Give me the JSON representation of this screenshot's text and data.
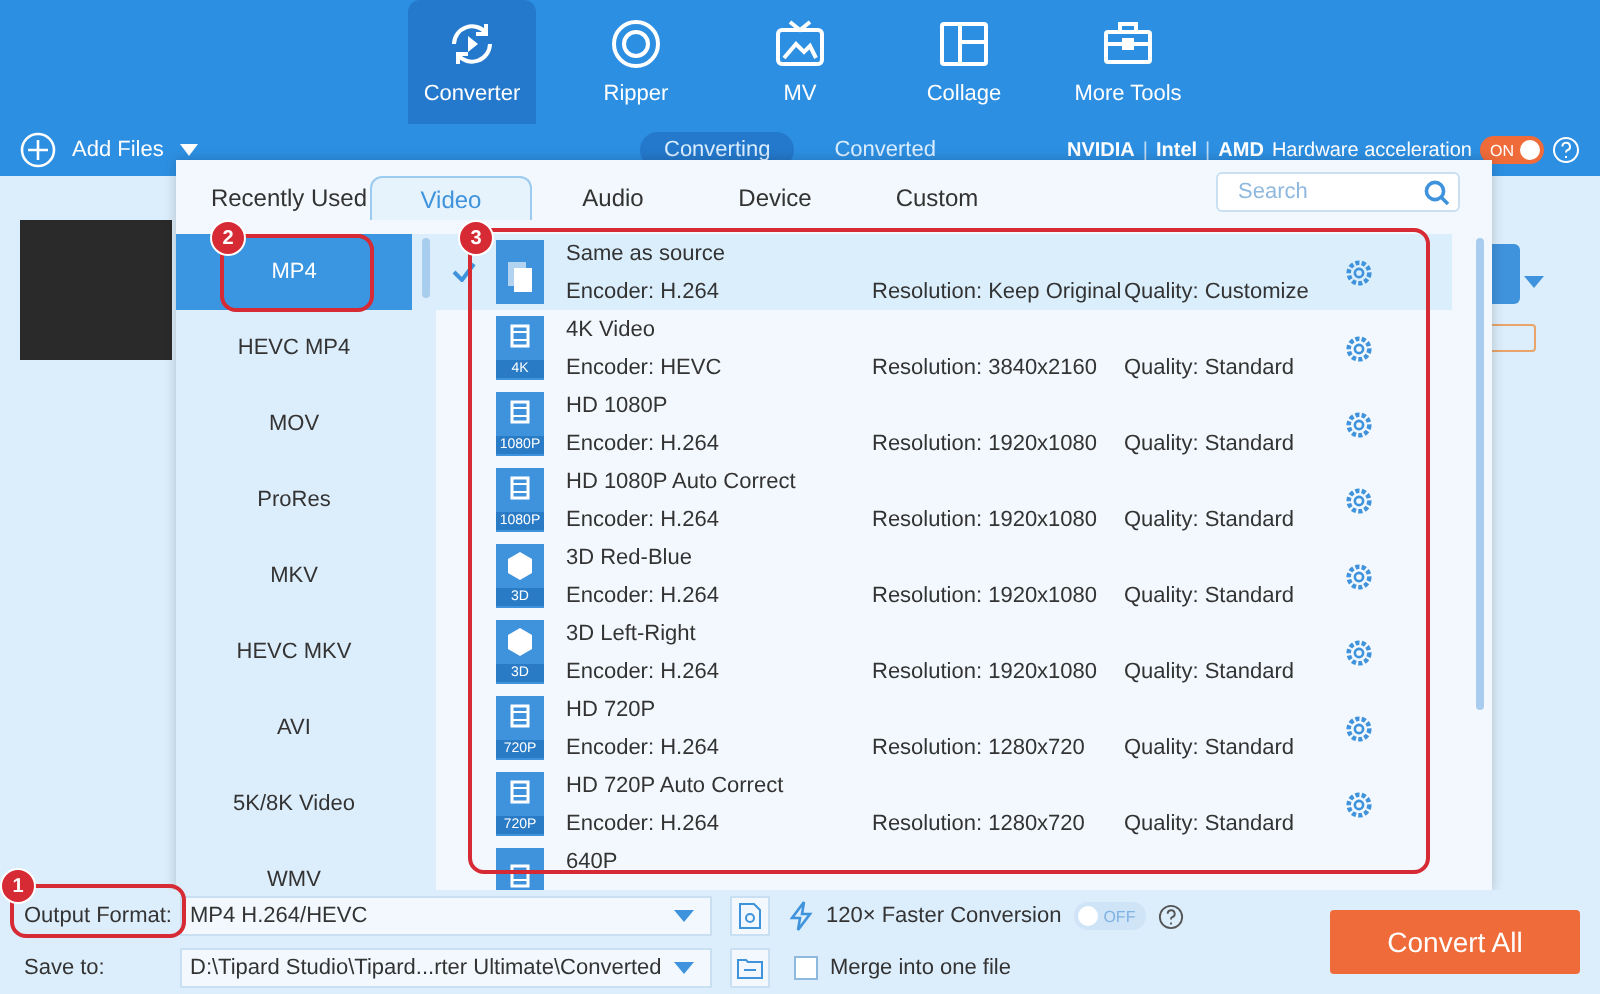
{
  "nav_tabs": [
    {
      "label": "Converter",
      "kind": "converter",
      "selected": true
    },
    {
      "label": "Ripper",
      "kind": "ripper",
      "selected": false
    },
    {
      "label": "MV",
      "kind": "mv",
      "selected": false
    },
    {
      "label": "Collage",
      "kind": "collage",
      "selected": false
    },
    {
      "label": "More Tools",
      "kind": "tools",
      "selected": false
    }
  ],
  "toolbar": {
    "add_files": "Add Files",
    "view_tabs": [
      {
        "label": "Converting",
        "selected": true
      },
      {
        "label": "Converted",
        "selected": false
      }
    ],
    "gpu_vendors": [
      "NVIDIA",
      "Intel",
      "AMD"
    ],
    "vendor_separator": "|",
    "hardware_acceleration": {
      "label": "Hardware acceleration",
      "toggle": {
        "text": "ON",
        "on": true
      }
    }
  },
  "format_dialog": {
    "tabs": [
      {
        "label": "Recently Used",
        "selected": false
      },
      {
        "label": "Video",
        "selected": true
      },
      {
        "label": "Audio",
        "selected": false
      },
      {
        "label": "Device",
        "selected": false
      },
      {
        "label": "Custom",
        "selected": false
      }
    ],
    "search": {
      "placeholder": "Search"
    },
    "categories": [
      {
        "label": "MP4",
        "selected": true
      },
      {
        "label": "HEVC MP4",
        "selected": false
      },
      {
        "label": "MOV",
        "selected": false
      },
      {
        "label": "ProRes",
        "selected": false
      },
      {
        "label": "MKV",
        "selected": false
      },
      {
        "label": "HEVC MKV",
        "selected": false
      },
      {
        "label": "AVI",
        "selected": false
      },
      {
        "label": "5K/8K Video",
        "selected": false
      },
      {
        "label": "WMV",
        "selected": false
      }
    ],
    "presets": [
      {
        "name": "Same as source",
        "kind": "copy",
        "encoder": "Encoder: H.264",
        "resolution": "Resolution: Keep Original",
        "quality": "Quality: Customize",
        "selected": true
      },
      {
        "name": "4K Video",
        "kind": "film",
        "badge": "4K",
        "encoder": "Encoder: HEVC",
        "resolution": "Resolution: 3840x2160",
        "quality": "Quality: Standard",
        "selected": false
      },
      {
        "name": "HD 1080P",
        "kind": "film",
        "badge": "1080P",
        "encoder": "Encoder: H.264",
        "resolution": "Resolution: 1920x1080",
        "quality": "Quality: Standard",
        "selected": false
      },
      {
        "name": "HD 1080P Auto Correct",
        "kind": "film",
        "badge": "1080P",
        "encoder": "Encoder: H.264",
        "resolution": "Resolution: 1920x1080",
        "quality": "Quality: Standard",
        "selected": false
      },
      {
        "name": "3D Red-Blue",
        "kind": "cube",
        "badge": "3D",
        "encoder": "Encoder: H.264",
        "resolution": "Resolution: 1920x1080",
        "quality": "Quality: Standard",
        "selected": false
      },
      {
        "name": "3D Left-Right",
        "kind": "cube",
        "badge": "3D",
        "encoder": "Encoder: H.264",
        "resolution": "Resolution: 1920x1080",
        "quality": "Quality: Standard",
        "selected": false
      },
      {
        "name": "HD 720P",
        "kind": "film",
        "badge": "720P",
        "encoder": "Encoder: H.264",
        "resolution": "Resolution: 1280x720",
        "quality": "Quality: Standard",
        "selected": false
      },
      {
        "name": "HD 720P Auto Correct",
        "kind": "film",
        "badge": "720P",
        "encoder": "Encoder: H.264",
        "resolution": "Resolution: 1280x720",
        "quality": "Quality: Standard",
        "selected": false
      },
      {
        "name": "640P",
        "kind": "film",
        "selected": false
      }
    ]
  },
  "annotations": [
    {
      "number": "1"
    },
    {
      "number": "2"
    },
    {
      "number": "3"
    }
  ],
  "bottom_bar": {
    "output_format": {
      "label": "Output Format:",
      "value": "MP4 H.264/HEVC"
    },
    "faster_conversion": {
      "label": "120× Faster Conversion",
      "toggle": {
        "text": "OFF",
        "on": false
      }
    },
    "save_to": {
      "label": "Save to:",
      "value": "D:\\Tipard Studio\\Tipard...rter Ultimate\\Converted"
    },
    "merge": {
      "label": "Merge into one file",
      "checked": false
    },
    "convert_all": "Convert All"
  }
}
